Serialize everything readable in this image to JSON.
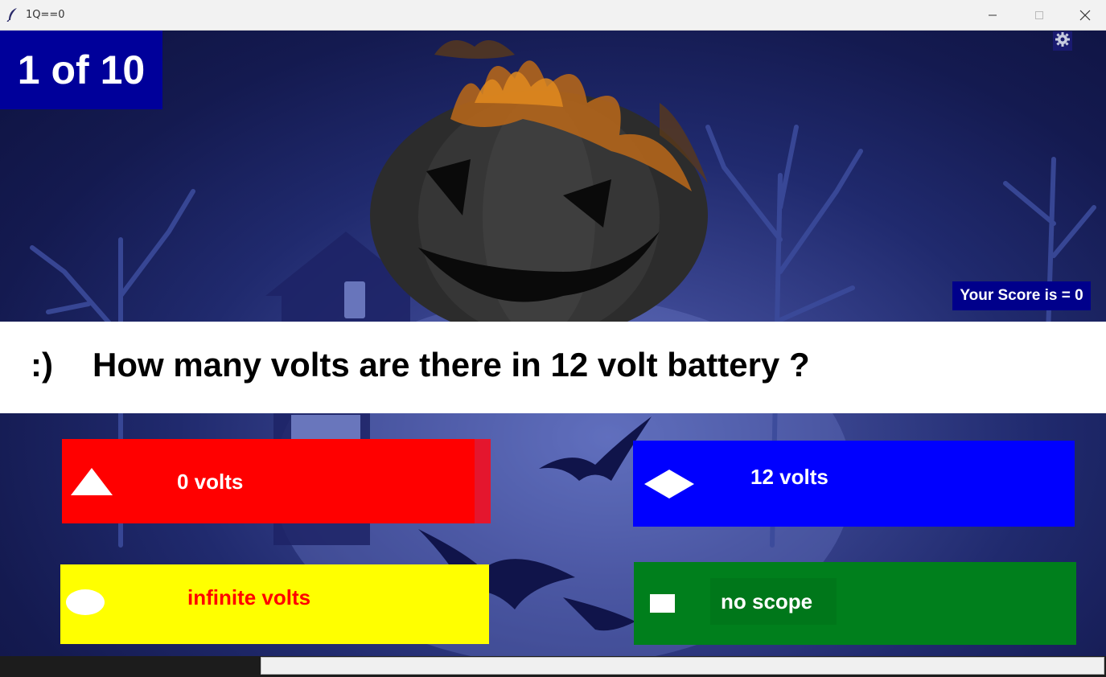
{
  "window": {
    "title": "1Q==0"
  },
  "game": {
    "counter": "1 of 10",
    "score_text": "Your Score is = 0",
    "question_prefix": ":)",
    "question": "How many volts are there in 12 volt battery ?",
    "answers": [
      {
        "label": "0 volts",
        "color": "#ff0000",
        "text_color": "#ffffff",
        "shape": "triangle-icon"
      },
      {
        "label": "12 volts",
        "color": "#0000ff",
        "text_color": "#ffffff",
        "shape": "diamond-icon"
      },
      {
        "label": "infinite volts",
        "color": "#ffff00",
        "text_color": "#ff0000",
        "shape": "circle-icon"
      },
      {
        "label": "no scope",
        "color": "#007f1c",
        "text_color": "#ffffff",
        "shape": "square-icon"
      }
    ]
  },
  "colors": {
    "counter_bg": "#00009a",
    "score_bg": "#00008b",
    "scene_bg": "#141a50"
  },
  "icons": [
    "feather-icon",
    "minimize-icon",
    "maximize-icon",
    "close-icon",
    "gear-icon"
  ]
}
